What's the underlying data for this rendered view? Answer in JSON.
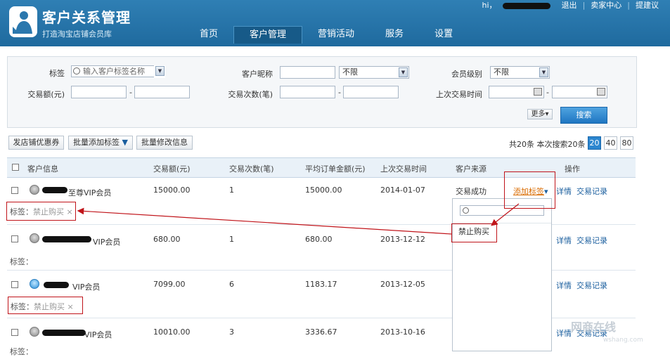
{
  "header": {
    "title": "客户关系管理",
    "subtitle": "打造淘宝店铺会员库",
    "greeting": "hi，",
    "links": [
      "退出",
      "卖家中心",
      "提建议"
    ],
    "nav": [
      {
        "label": "首页",
        "active": false
      },
      {
        "label": "客户管理",
        "active": true
      },
      {
        "label": "营销活动",
        "active": false
      },
      {
        "label": "服务",
        "active": false
      },
      {
        "label": "设置",
        "active": false
      }
    ]
  },
  "filter": {
    "tag_label": "标签",
    "tag_placeholder": "输入客户标签名称",
    "nickname_label": "客户昵称",
    "nickname_option": "不限",
    "level_label": "会员级别",
    "level_option": "不限",
    "amount_label": "交易额(元)",
    "count_label": "交易次数(笔)",
    "last_time_label": "上次交易时间",
    "dash": "-",
    "more_label": "更多",
    "search_label": "搜索"
  },
  "toolbar": {
    "coupon_label": "发店铺优惠券",
    "batch_tag_label": "批量添加标签",
    "batch_edit_label": "批量修改信息",
    "pager_text": "共20条 本次搜索20条",
    "page_sizes": [
      "20",
      "40",
      "80"
    ]
  },
  "table": {
    "headers": [
      "客户信息",
      "交易额(元)",
      "交易次数(笔)",
      "平均订单金额(元)",
      "上次交易时间",
      "客户来源",
      "操作"
    ],
    "tag_prefix": "标签：",
    "rows": [
      {
        "member": "至尊VIP会员",
        "amount": "15000.00",
        "count": "1",
        "avg": "15000.00",
        "last": "2014-01-07",
        "source": "交易成功",
        "tag": "禁止购买",
        "avatar": "gray"
      },
      {
        "member": "VIP会员",
        "amount": "680.00",
        "count": "1",
        "avg": "680.00",
        "last": "2013-12-12",
        "source": "",
        "tag": "",
        "avatar": "gray"
      },
      {
        "member": "VIP会员",
        "amount": "7099.00",
        "count": "6",
        "avg": "1183.17",
        "last": "2013-12-05",
        "source": "",
        "tag": "禁止购买",
        "avatar": "blue"
      },
      {
        "member": "VIP会员",
        "amount": "10010.00",
        "count": "3",
        "avg": "3336.67",
        "last": "2013-10-16",
        "source": "",
        "tag": "",
        "avatar": "gray"
      }
    ],
    "add_tag_label": "添加标签",
    "detail_label": "详情",
    "records_label": "交易记录"
  },
  "dropdown": {
    "item": "禁止购买"
  },
  "watermark": {
    "text": "网商在线",
    "sub": "wshang.com"
  },
  "colors": {
    "header_bg": "#2572a8",
    "annotation_red": "#c0141a",
    "active_page": "#2c86cf"
  }
}
